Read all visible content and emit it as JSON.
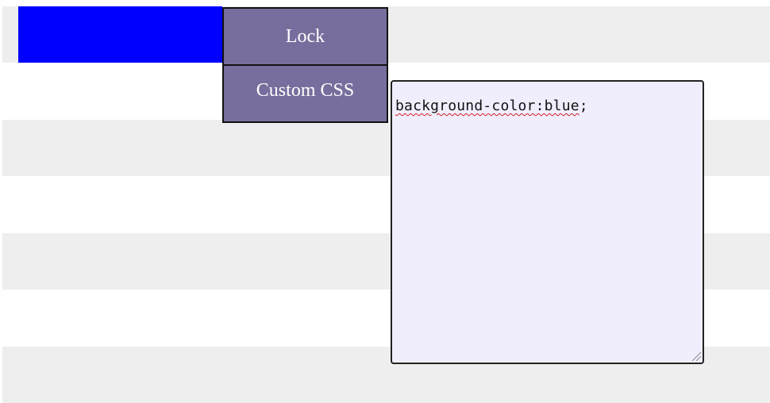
{
  "toolbar": {
    "lock_label": "Lock",
    "custom_css_label": "Custom CSS"
  },
  "preview": {
    "background_color": "#0000ff"
  },
  "css_editor": {
    "text_misspelled": "background-color:blue",
    "text_rest": ";"
  },
  "colors": {
    "stripe_shaded": "#eeeeee",
    "stripe_plain": "#ffffff",
    "button_bg": "#786e9d",
    "editor_bg": "#f0eefd"
  }
}
